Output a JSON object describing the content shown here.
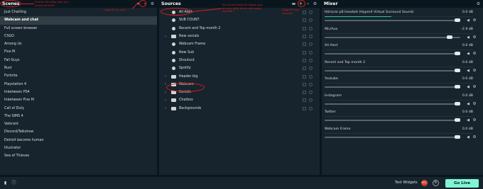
{
  "scenes": {
    "title": "Scenes",
    "items": [
      "Just Chatting",
      "Webcam and chat",
      "Full screen browser",
      "CSGO",
      "Among Us",
      "Five M",
      "Fall Guys",
      "Rust",
      "Fortnite",
      "Playstation 4",
      "Inbetween PS4",
      "Inbetween Five M",
      "Call of Duty",
      "The SIMS 4",
      "Valorant",
      "Discord/Talkshow",
      "Detroit become human",
      "Illustrator",
      "Sea of Thieves"
    ],
    "active_index": 1
  },
  "sources": {
    "title": "Sources",
    "items": [
      {
        "label": "All Alert",
        "type": "item",
        "expandable": false
      },
      {
        "label": "SUB COUNT",
        "type": "item",
        "expandable": false
      },
      {
        "label": "Recent and Top month 2",
        "type": "item",
        "expandable": false
      },
      {
        "label": "New socials",
        "type": "folder",
        "expandable": true
      },
      {
        "label": "Webcam Frame",
        "type": "item",
        "expandable": false
      },
      {
        "label": "New Sub",
        "type": "item",
        "expandable": false
      },
      {
        "label": "Shoutout",
        "type": "item",
        "expandable": false
      },
      {
        "label": "Spotify",
        "type": "item",
        "expandable": false
      },
      {
        "label": "Header big",
        "type": "folder",
        "expandable": true
      },
      {
        "label": "Webcam",
        "type": "folder",
        "expandable": true
      },
      {
        "label": "Socials",
        "type": "folder",
        "expandable": true
      },
      {
        "label": "Chatbox",
        "type": "folder",
        "expandable": true
      },
      {
        "label": "Backgrounds",
        "type": "folder",
        "expandable": true
      }
    ]
  },
  "mixer": {
    "title": "Mixer",
    "items": [
      {
        "name": "Hörlurar på headset (HyperX Virtual Surround Sound)",
        "db": "0.0 dB",
        "level": 1.0,
        "meter": 0.45
      },
      {
        "name": "Mic/Aux",
        "db": "-2.9 dB",
        "level": 0.94,
        "meter": 0.0
      },
      {
        "name": "All Alert",
        "db": "0.0 dB",
        "level": 1.0,
        "meter": 0.0
      },
      {
        "name": "Recent and Top month 2",
        "db": "0.0 dB",
        "level": 1.0,
        "meter": 0.0
      },
      {
        "name": "Youtube",
        "db": "0.0 dB",
        "level": 1.0,
        "meter": 0.0
      },
      {
        "name": "Instagram",
        "db": "0.0 dB",
        "level": 1.0,
        "meter": 0.0
      },
      {
        "name": "Twitter",
        "db": "0.0 dB",
        "level": 1.0,
        "meter": 0.0
      },
      {
        "name": "Webcam Frame",
        "db": "0.0 dB",
        "level": 1.0,
        "meter": 0.0
      }
    ]
  },
  "footer": {
    "test_widgets": "Test Widgets",
    "rec_label": "REC",
    "go_live": "Go Live"
  },
  "annotations": {
    "scenes_note": "Scener för olika spel och annat innehåll",
    "add_scene_note": "Lägg till ny scen",
    "sources_note": "Se till att Alerts är högst upp, annars döljs de av alla lager ovanför!",
    "add_source_note": "Lägg till nya sources"
  },
  "colors": {
    "background": "#09161d",
    "panel": "#17242d",
    "active_row": "#313e46",
    "accent": "#80f5d2",
    "record": "#d23d2d",
    "annotation": "#e01b1b"
  }
}
